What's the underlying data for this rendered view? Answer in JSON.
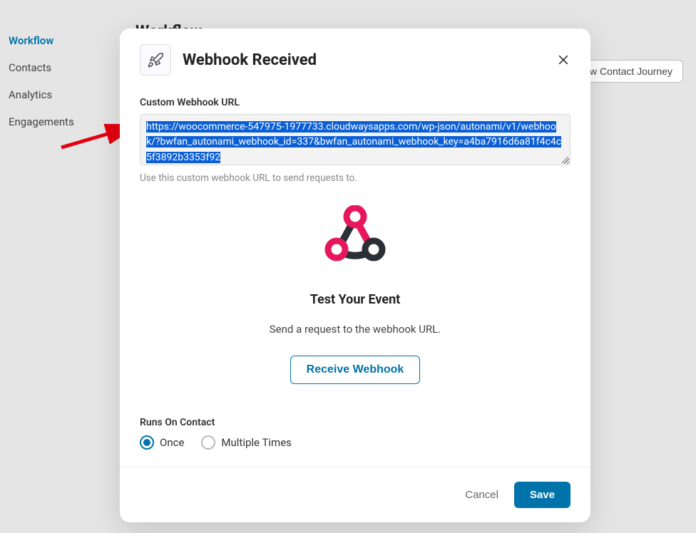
{
  "sidebar": {
    "items": [
      {
        "label": "Workflow",
        "active": true
      },
      {
        "label": "Contacts",
        "active": false
      },
      {
        "label": "Analytics",
        "active": false
      },
      {
        "label": "Engagements",
        "active": false
      }
    ]
  },
  "background": {
    "page_title_partial": "Workflow",
    "journey_button_partial": "ew Contact Journey"
  },
  "modal": {
    "icon_name": "rocket-icon",
    "title": "Webhook Received",
    "url_label": "Custom Webhook URL",
    "url_value": "https://woocommerce-547975-1977733.cloudwaysapps.com/wp-json/autonami/v1/webhook/?bwfan_autonami_webhook_id=337&bwfan_autonami_webhook_key=a4ba7916d6a81f4c4c5f3892b3353f92",
    "url_hint": "Use this custom webhook URL to send requests to.",
    "test_title": "Test Your Event",
    "test_desc": "Send a request to the webhook URL.",
    "receive_button": "Receive Webhook",
    "runs_label": "Runs On Contact",
    "runs_options": {
      "once": "Once",
      "multiple": "Multiple Times"
    },
    "runs_selected": "once",
    "cancel_label": "Cancel",
    "save_label": "Save"
  }
}
